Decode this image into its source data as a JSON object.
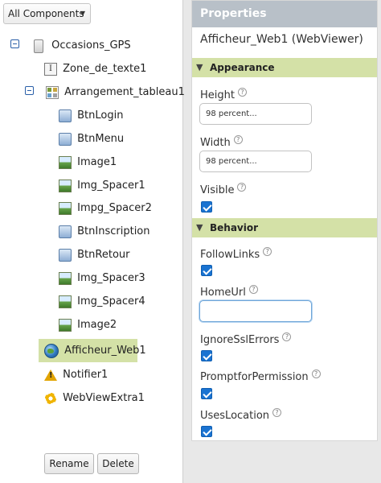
{
  "components_panel": {
    "dropdown_label": "All Components",
    "tree": [
      {
        "label": "Occasions_GPS",
        "icon": "screen-icon"
      },
      {
        "label": "Zone_de_texte1",
        "icon": "textbox-icon"
      },
      {
        "label": "Arrangement_tableau1",
        "icon": "table-arrangement-icon"
      },
      {
        "label": "BtnLogin",
        "icon": "button-icon"
      },
      {
        "label": "BtnMenu",
        "icon": "button-icon"
      },
      {
        "label": "Image1",
        "icon": "image-icon"
      },
      {
        "label": "Img_Spacer1",
        "icon": "image-icon"
      },
      {
        "label": "Impg_Spacer2",
        "icon": "image-icon"
      },
      {
        "label": "BtnInscription",
        "icon": "button-icon"
      },
      {
        "label": "BtnRetour",
        "icon": "button-icon"
      },
      {
        "label": "Img_Spacer3",
        "icon": "image-icon"
      },
      {
        "label": "Img_Spacer4",
        "icon": "image-icon"
      },
      {
        "label": "Image2",
        "icon": "image-icon"
      },
      {
        "label": "Afficheur_Web1",
        "icon": "webviewer-globe-icon",
        "selected": true
      },
      {
        "label": "Notifier1",
        "icon": "warning-icon"
      },
      {
        "label": "WebViewExtra1",
        "icon": "extension-gear-icon"
      }
    ],
    "rename_label": "Rename",
    "delete_label": "Delete"
  },
  "properties_panel": {
    "header": "Properties",
    "component_title": "Afficheur_Web1 (WebViewer)",
    "sections": {
      "appearance": "Appearance",
      "behavior": "Behavior"
    },
    "properties": {
      "height": {
        "label": "Height",
        "value": "98 percent..."
      },
      "width": {
        "label": "Width",
        "value": "98 percent..."
      },
      "visible": {
        "label": "Visible",
        "checked": true
      },
      "follow_links": {
        "label": "FollowLinks",
        "checked": true
      },
      "home_url": {
        "label": "HomeUrl",
        "value": ""
      },
      "ignore_ssl_errors": {
        "label": "IgnoreSslErrors",
        "checked": true
      },
      "prompt_for_permission": {
        "label": "PromptforPermission",
        "checked": true
      },
      "uses_location": {
        "label": "UsesLocation",
        "checked": true
      }
    },
    "help_glyph": "?"
  },
  "colors": {
    "selection": "#d4e1a7",
    "header": "#b8c0c8",
    "checkbox": "#1a73d1"
  }
}
